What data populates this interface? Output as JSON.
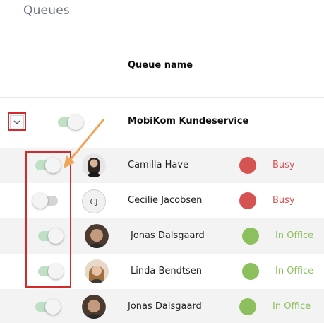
{
  "page": {
    "title": "Queues"
  },
  "table": {
    "column_queue_name": "Queue name"
  },
  "group": {
    "name": "MobiKom Kundeservice",
    "toggle_on": true,
    "expand_icon": "chevron-down-icon"
  },
  "colors": {
    "busy": "#d65353",
    "in_office": "#8cbf5e",
    "toggle_on": "#bfe0c5",
    "highlight": "#d12b2b",
    "arrow": "#f0a65a"
  },
  "agents": [
    {
      "name": "Camilla Have",
      "status": "Busy",
      "toggle_on": true,
      "avatar": "photo"
    },
    {
      "name": "Cecilie Jacobsen",
      "status": "Busy",
      "toggle_on": false,
      "avatar": "initials",
      "initials": "CJ"
    },
    {
      "name": "Jonas Dalsgaard",
      "status": "In Office",
      "toggle_on": true,
      "avatar": "photo"
    },
    {
      "name": "Linda Bendtsen",
      "status": "In Office",
      "toggle_on": true,
      "avatar": "photo"
    },
    {
      "name": "Jonas Dalsgaard",
      "status": "In Office",
      "toggle_on": true,
      "avatar": "photo"
    }
  ]
}
